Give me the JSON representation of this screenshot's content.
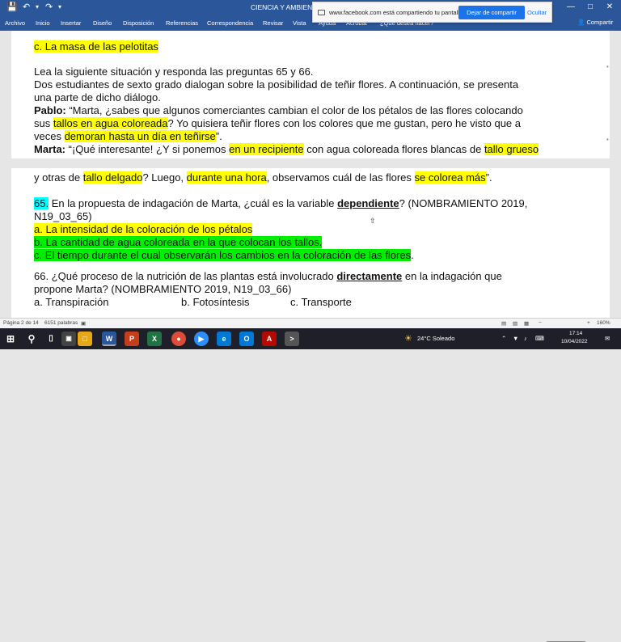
{
  "titlebar": {
    "doc_title": "CIENCIA Y AMBIENTE p..."
  },
  "ribbon": {
    "tabs": [
      "Archivo",
      "Inicio",
      "Insertar",
      "Diseño",
      "Disposición",
      "Referencias",
      "Correspondencia",
      "Revisar",
      "Vista",
      "Ayuda",
      "Acrobat",
      "¿Qué desea hacer?"
    ],
    "share": "Compartir"
  },
  "notification": {
    "text": "www.facebook.com está compartiendo tu pantalla.",
    "stop_label": "Dejar de compartir",
    "hide_label": "Ocultar"
  },
  "document": {
    "line_top": "c. La masa de las pelotitas",
    "intro1": "Lea la siguiente situación y responda las preguntas 65 y  66.",
    "intro2": "Dos estudiantes de sexto grado dialogan sobre la posibilidad de teñir flores. A continuación, se presenta",
    "intro3": "una parte de dicho diálogo.",
    "pablo_label": "Pablo:",
    "pablo1_a": " “Marta, ¿sabes que algunos comerciantes cambian el color de los pétalos de las flores colocando",
    "pablo2_a": "sus ",
    "pablo2_hl": "tallos en agua coloreada",
    "pablo2_b": "? Yo quisiera teñir flores con los colores que me gustan, pero he visto que a",
    "pablo3_a": "veces ",
    "pablo3_hl": "demoran hasta un día en teñirse",
    "pablo3_b": "”.",
    "marta_label": "Marta:",
    "marta1_a": " “¡Qué interesante! ¿Y si ponemos ",
    "marta1_hl1": "en un recipiente",
    "marta1_b": " con agua coloreada flores blancas de ",
    "marta1_hl2": "tallo grueso",
    "marta2_a": "y otras de ",
    "marta2_hl1": "tallo delgado",
    "marta2_b": "? Luego, ",
    "marta2_hl2": "durante una hora",
    "marta2_c": ", observamos cuál de las flores ",
    "marta2_hl3": "se colorea más",
    "marta2_d": "”.",
    "q65_num": "65.",
    "q65_a": " En la propuesta de indagación de Marta, ¿cuál es la variable ",
    "q65_ul": "dependiente",
    "q65_b": "? (NOMBRAMIENTO 2019,",
    "q65_c": "N19_03_65)",
    "opt_a": "a. La intensidad de la coloración de los pétalos",
    "opt_b": "b. La cantidad de agua coloreada en la que colocan los tallos.",
    "opt_c": "c. El tiempo durante el cual observarán los cambios en la coloración de las flores",
    "q66_a": "66. ¿Qué proceso de la nutrición de las plantas está involucrado ",
    "q66_ul": "directamente",
    "q66_b": " en la indagación que",
    "q66_c": "propone Marta? (NOMBRAMIENTO 2019, N19_03_66)",
    "q66_opt_a": "a. Transpiración",
    "q66_opt_b": "b. Fotosíntesis",
    "q66_opt_c": "c. Transporte"
  },
  "statusbar": {
    "page": "Página 2 de 14",
    "words": "6151 palabras",
    "zoom": "160%"
  },
  "taskbar": {
    "weather": "24°C  Soleado",
    "time": "17:14",
    "date": "10/04/2022"
  }
}
